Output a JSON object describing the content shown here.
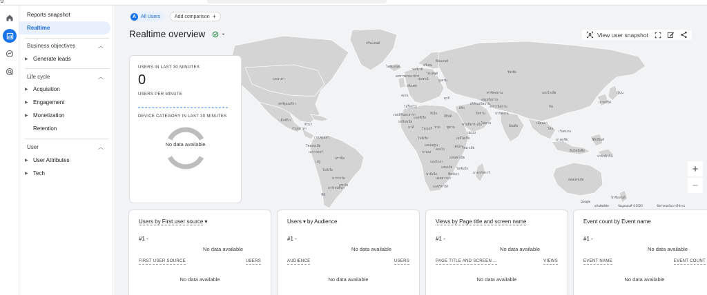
{
  "topbar": {
    "fragment": "g"
  },
  "rail": {
    "items": [
      {
        "icon": "home-icon"
      },
      {
        "icon": "bar-chart-icon",
        "active": true
      },
      {
        "icon": "explore-icon"
      },
      {
        "icon": "advertising-icon"
      }
    ]
  },
  "sidenav": {
    "reports_snapshot": "Reports snapshot",
    "realtime": "Realtime",
    "business_objectives": "Business objectives",
    "generate_leads": "Generate leads",
    "life_cycle": "Life cycle",
    "acquisition": "Acquisition",
    "engagement": "Engagement",
    "monetization": "Monetization",
    "retention": "Retention",
    "user": "User",
    "user_attributes": "User Attributes",
    "tech": "Tech"
  },
  "filters": {
    "audience_letter": "A",
    "audience_label": "All Users",
    "add_comparison": "Add comparison"
  },
  "header": {
    "title": "Realtime overview",
    "view_snapshot": "View user snapshot"
  },
  "map_labels": {
    "greenland": "กรีนแลนด์",
    "iceland": "ไอซ์แลนด์",
    "russia": "รัสเซีย",
    "canada": "แคนาดา",
    "usa": "สหรัฐอเมริกา",
    "mexico": "เม็กซิโก",
    "venezuela": "เวเนซุเอลา",
    "colombia": "โคลอมเบีย",
    "brazil": "บราซิล",
    "peru": "เปรู",
    "bolivia": "โบลิเวีย",
    "argentina": "อาร์เจนตินา",
    "chile": "ชิลี",
    "kazakhstan": "คาซัคสถาน",
    "mongolia": "มองโกเลีย",
    "china": "จีน",
    "india": "อินเดีย",
    "iran": "อิหร่าน",
    "saudi": "ซาอุดีอาระเบีย",
    "egypt": "อียิปต์",
    "algeria": "แอลจีเรีย",
    "libya": "ลิเบีย",
    "niger": "ไนเจอร์",
    "chad": "ชาด",
    "sudan": "ซูดาน",
    "nigeria": "ไนจีเรีย",
    "ethiopia": "เอธิโอเปีย",
    "drc": "คองโก",
    "tanzania": "แทนซาเนีย",
    "angola": "แองโกลา",
    "namibia": "นามิเบีย",
    "south_africa": "แอฟริกาใต้",
    "madagascar": "มาดากัสการ์",
    "indonesia": "อินโดนีเซีย",
    "japan": "ญี่ปุ่น",
    "thailand": "ไทย",
    "philippines": "ฟิลิปปินส์",
    "australia": "ออสเตรเลีย",
    "new_zealand": "นิวซีแลนด์",
    "ukraine": "ยูเครน",
    "finland": "ฟินแลนด์",
    "sweden": "สวีเดน",
    "norway": "นอร์เวย์",
    "uk": "สหราชอาณาจักร",
    "spain": "สเปน",
    "france": "ฝรั่งเศส",
    "germany": "เยอรมนี",
    "poland": "โปแลนด์",
    "turkey": "ตุรกี",
    "pakistan": "ปากีสถาน",
    "afghanistan": "อัฟกานิสถาน",
    "iraq": "อิรัก",
    "mali": "มาลี",
    "mauritania": "มอริเตเนีย",
    "somalia": "โซมาเลีย",
    "kenya": "เคนยา",
    "zambia": "แซมเบีย",
    "botswana": "บอตสวานา",
    "cuba": "คิวบา",
    "guatemala": "กัวเตมาลา",
    "ecuador": "เอกวาดอร์",
    "paraguay": "ปารากวัย",
    "uruguay": "อุรุกวัย",
    "uzbekistan": "อุซเบกิสถาน",
    "turkmenistan": "เติร์กเมนิสถาน",
    "myanmar": "เมียนมา",
    "vietnam": "เวียดนาม",
    "malaysia": "มาเลเซีย",
    "png": "ปาปัวนิวกินี",
    "korea": "เกาหลีใต้",
    "yemen": "เยเมน",
    "oman": "โอมาน",
    "morocco": "โมร็อกโก",
    "western_sahara": "เวสเทิร์นสะฮารา",
    "cameroon": "แคเมอรูน",
    "gabon": "กาบอง",
    "mozambique": "โมซัมบิก",
    "zimbabwe": "ซิมบับเว",
    "footer_keyboard": "แป้นพิมพ์ลัด",
    "footer_data": "ข้อมูลแผนที่ ©2023",
    "footer_terms": "ข้อกำหนดในการใช้งาน",
    "google": "Google"
  },
  "realtime_card": {
    "users_label": "USERS IN LAST 30 MINUTES",
    "users_value": "0",
    "per_minute_label": "USERS PER MINUTE",
    "device_label": "DEVICE CATEGORY IN LAST 30 MINUTES",
    "no_data": "No data available"
  },
  "cards": [
    {
      "title_main": "Users by First user source",
      "title_dd": "▾",
      "title_rest": "",
      "rank": "#1  -",
      "no_data_1": "No data available",
      "col_left": "FIRST USER SOURCE",
      "col_right": "USERS",
      "no_data_2": "No data available"
    },
    {
      "title_main": "Users",
      "title_dd": "▾",
      "title_rest": " by Audience",
      "rank": "#1  -",
      "no_data_1": "No data available",
      "col_left": "AUDIENCE",
      "col_right": "USERS",
      "no_data_2": "No data available"
    },
    {
      "title_main": "Views by Page title and screen name",
      "title_dd": "",
      "title_rest": "",
      "rank": "#1  -",
      "no_data_1": "No data available",
      "col_left": "PAGE TITLE AND SCREEN ...",
      "col_right": "VIEWS",
      "no_data_2": "No data available"
    },
    {
      "title_main": "Event count by Event name",
      "title_dd": "",
      "title_rest": "",
      "rank": "#1  -",
      "no_data_1": "No data available",
      "col_left": "EVENT NAME",
      "col_right": "EVENT COUNT",
      "no_data_2": "No data available"
    }
  ],
  "colors": {
    "accent": "#1a73e8",
    "land": "#d4d4d4",
    "water": "#f1f3f4",
    "donut": "#bdbdbd"
  }
}
